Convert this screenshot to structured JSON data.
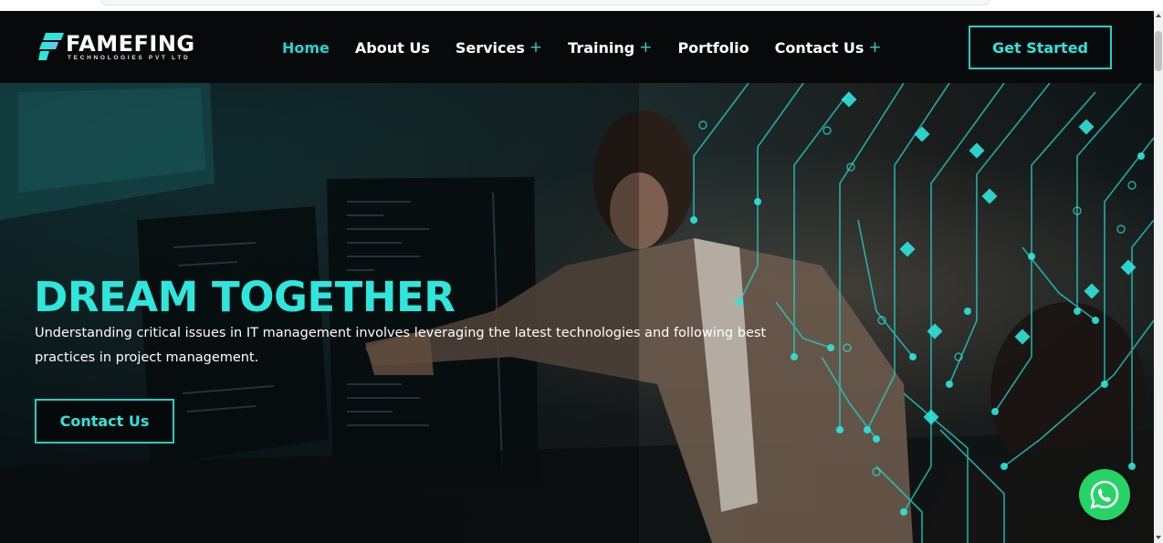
{
  "brand": {
    "name_part1": "FAME",
    "name_part2": "FING",
    "tagline": "TECHNOLOGIES PVT LTD",
    "accent_color": "#2ee6dc"
  },
  "nav": {
    "items": [
      {
        "label": "Home",
        "active": true,
        "has_submenu": false
      },
      {
        "label": "About Us",
        "active": false,
        "has_submenu": false
      },
      {
        "label": "Services",
        "active": false,
        "has_submenu": true
      },
      {
        "label": "Training",
        "active": false,
        "has_submenu": true
      },
      {
        "label": "Portfolio",
        "active": false,
        "has_submenu": false
      },
      {
        "label": "Contact Us",
        "active": false,
        "has_submenu": true
      }
    ],
    "submenu_indicator": "+",
    "cta_label": "Get Started"
  },
  "hero": {
    "title": "DREAM TOGETHER",
    "description": "Understanding critical issues in IT management involves leveraging the latest technologies and following best practices in project management.",
    "cta_label": "Contact Us"
  },
  "floating": {
    "icon": "whatsapp-icon",
    "color": "#25d366"
  }
}
